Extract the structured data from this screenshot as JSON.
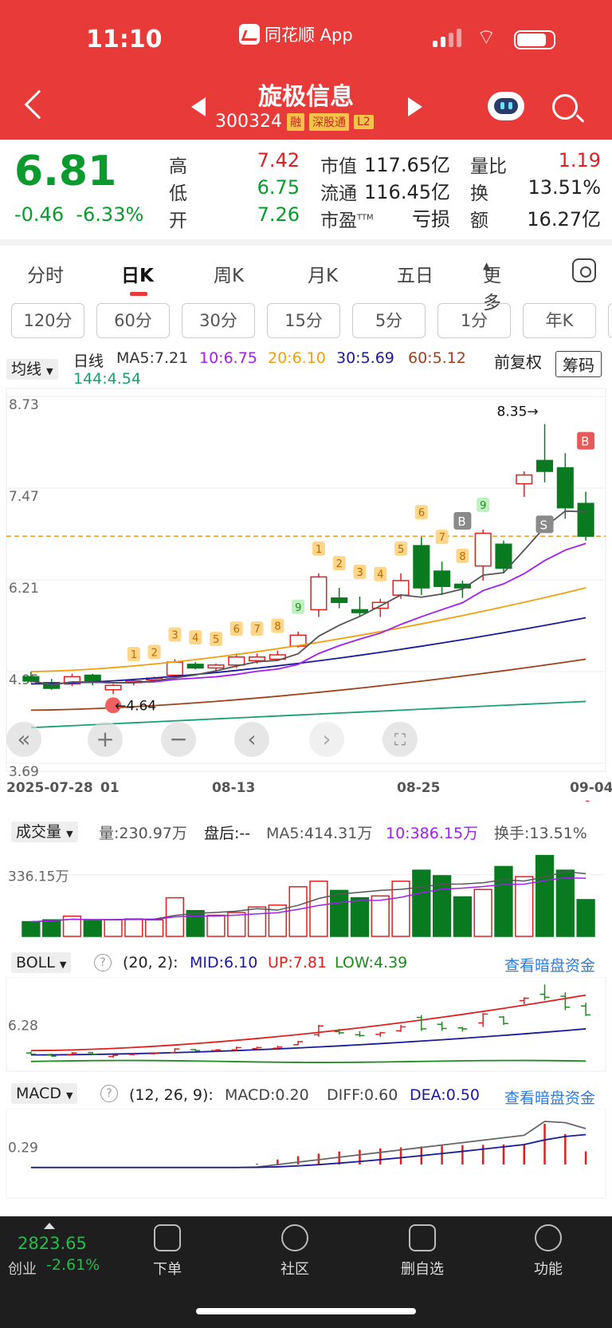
{
  "status_bar": {
    "time": "11:10",
    "app_name": "同花顺 App"
  },
  "header": {
    "stock_name": "旋极信息",
    "stock_code": "300324",
    "tags": [
      "融",
      "深股通",
      "L2"
    ]
  },
  "quote": {
    "price": "6.81",
    "change": "-0.46",
    "change_pct": "-6.33%",
    "high_label": "高",
    "high": "7.42",
    "low_label": "低",
    "low": "6.75",
    "open_label": "开",
    "open": "7.26",
    "mcap_label": "市值",
    "mcap": "117.65亿",
    "float_label": "流通",
    "float": "116.45亿",
    "pe_label": "市盈",
    "pe_sup": "TTM",
    "pe": "亏损",
    "vr_label": "量比",
    "vr": "1.19",
    "turn_label": "换",
    "turn": "13.51%",
    "amt_label": "额",
    "amt": "16.27亿"
  },
  "tabs": [
    "分时",
    "日K",
    "周K",
    "月K",
    "五日",
    "更多"
  ],
  "active_tab": "日K",
  "periods": [
    "120分",
    "60分",
    "30分",
    "15分",
    "5分",
    "1分",
    "年K"
  ],
  "ma_header": {
    "selector": "均线",
    "daily": "日线",
    "ma5": "MA5:7.21",
    "ma10": "10:6.75",
    "ma20": "20:6.10",
    "ma30": "30:5.69",
    "ma60": "60:5.12",
    "ma144": "144:4.54",
    "fq": "前复权",
    "chip": "筹码"
  },
  "kchart": {
    "y_labels": [
      "8.73",
      "7.47",
      "6.21",
      "4.95",
      "3.69"
    ],
    "high_note": "8.35→",
    "low_note": "←4.64",
    "x_labels": [
      "2025-07-28",
      "01",
      "08-13",
      "08-25",
      "09-04"
    ],
    "td_marks": [
      "1",
      "2",
      "3",
      "4",
      "5",
      "6",
      "7",
      "8",
      "9",
      "1",
      "2",
      "3",
      "4",
      "5",
      "6",
      "7",
      "8",
      "9"
    ],
    "bs_marks": [
      "B",
      "S",
      "B"
    ]
  },
  "chart_data": {
    "type": "candlestick",
    "x": [
      "2025-07-28",
      "08-13",
      "08-25",
      "09-04"
    ],
    "ylim": [
      3.69,
      8.73
    ],
    "ohlc": [
      [
        4.88,
        4.95,
        4.8,
        4.82
      ],
      [
        4.8,
        4.85,
        4.7,
        4.72
      ],
      [
        4.78,
        4.92,
        4.75,
        4.88
      ],
      [
        4.9,
        4.92,
        4.76,
        4.8
      ],
      [
        4.7,
        4.78,
        4.64,
        4.76
      ],
      [
        4.8,
        4.85,
        4.76,
        4.82
      ],
      [
        4.84,
        4.88,
        4.8,
        4.86
      ],
      [
        4.9,
        5.12,
        4.88,
        5.08
      ],
      [
        5.05,
        5.08,
        4.98,
        5.0
      ],
      [
        5.0,
        5.06,
        4.96,
        5.04
      ],
      [
        5.04,
        5.2,
        5.0,
        5.15
      ],
      [
        5.1,
        5.2,
        5.06,
        5.15
      ],
      [
        5.12,
        5.24,
        5.1,
        5.18
      ],
      [
        5.3,
        5.5,
        5.28,
        5.45
      ],
      [
        5.8,
        6.3,
        5.7,
        6.25
      ],
      [
        5.96,
        6.1,
        5.82,
        5.9
      ],
      [
        5.8,
        5.98,
        5.7,
        5.76
      ],
      [
        5.82,
        5.95,
        5.7,
        5.9
      ],
      [
        6.0,
        6.3,
        5.95,
        6.2
      ],
      [
        6.68,
        6.8,
        6.0,
        6.1
      ],
      [
        6.33,
        6.46,
        6.0,
        6.12
      ],
      [
        6.15,
        6.2,
        5.96,
        6.1
      ],
      [
        6.4,
        6.9,
        6.2,
        6.85
      ],
      [
        6.7,
        6.75,
        6.3,
        6.37
      ],
      [
        7.53,
        7.7,
        7.35,
        7.65
      ],
      [
        7.85,
        8.35,
        7.55,
        7.7
      ],
      [
        7.75,
        7.95,
        7.05,
        7.2
      ],
      [
        7.26,
        7.42,
        6.75,
        6.81
      ]
    ],
    "ma5_last": 7.21,
    "ma10_last": 6.75,
    "ma20_last": 6.1,
    "ma30_last": 5.69,
    "ma60_last": 5.12,
    "ma144_last": 4.54
  },
  "volume": {
    "selector": "成交量",
    "vol": "量:230.97万",
    "after": "盘后:--",
    "ma5": "MA5:414.31万",
    "ma10": "10:386.15万",
    "turn": "换手:13.51%",
    "y_label": "336.15万",
    "values": [
      80,
      90,
      110,
      85,
      90,
      95,
      90,
      210,
      140,
      115,
      130,
      160,
      170,
      270,
      300,
      250,
      210,
      220,
      300,
      360,
      330,
      215,
      255,
      380,
      325,
      440,
      360,
      200
    ]
  },
  "boll": {
    "selector": "BOLL",
    "params": "(20, 2):",
    "mid": "MID:6.10",
    "up": "UP:7.81",
    "low": "LOW:4.39",
    "link": "查看暗盘资金",
    "y_label": "6.28"
  },
  "macd": {
    "selector": "MACD",
    "params": "(12, 26, 9):",
    "macd": "MACD:0.20",
    "diff": "DIFF:0.60",
    "dea": "DEA:0.50",
    "link": "查看暗盘资金",
    "y_label": "0.29"
  },
  "footer": {
    "index_value": "2823.65",
    "index_name": "创业",
    "index_pct": "-2.61%",
    "items": [
      "下单",
      "社区",
      "删自选",
      "功能"
    ]
  },
  "colors": {
    "up": "#e02020",
    "down": "#0a7a20",
    "header": "#e93a3a"
  }
}
